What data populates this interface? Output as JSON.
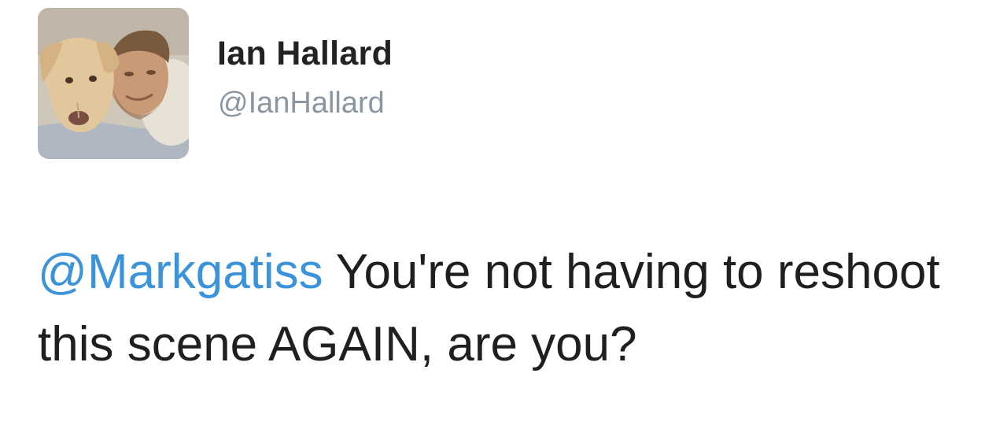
{
  "author": {
    "display_name": "Ian Hallard",
    "handle": "@IanHallard",
    "avatar_icon": "profile-photo-man-with-dog"
  },
  "tweet": {
    "mention": "@Markgatiss",
    "text": " You're not having to reshoot this scene AGAIN, are you?"
  },
  "colors": {
    "mention": "#3b94d9",
    "handle": "#8a97a3",
    "text": "#1f1f1f"
  }
}
